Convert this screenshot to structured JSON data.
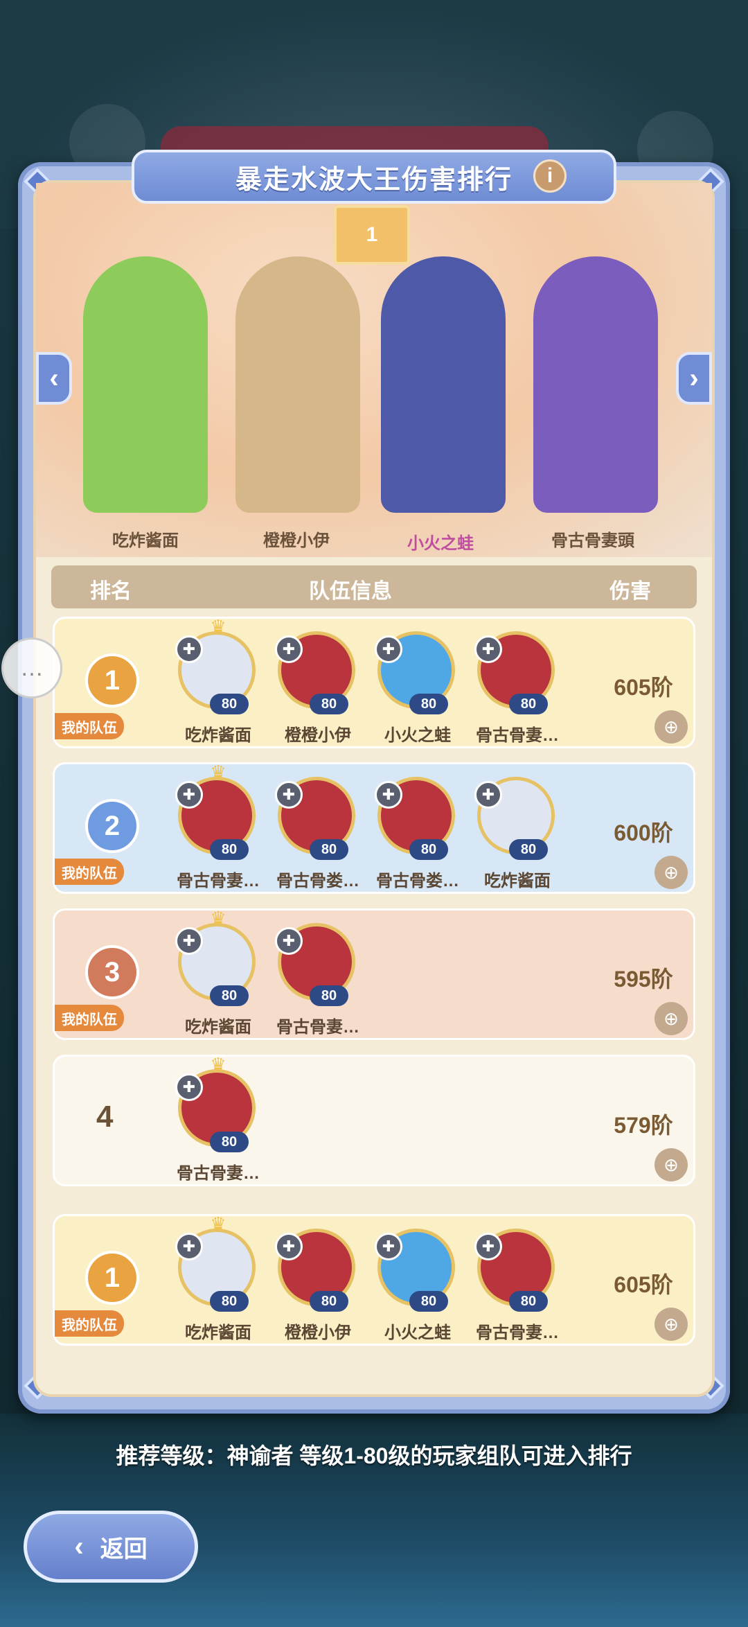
{
  "title": "暴走水波大王伤害排行",
  "top_rank": "1",
  "characters": [
    {
      "name": "吃炸酱面",
      "color": "#8dcc5b"
    },
    {
      "name": "橙橙小伊",
      "color": "#d6b78a"
    },
    {
      "name": "小火之蛙",
      "color": "#4e5aa8"
    },
    {
      "name": "骨古骨妻頭",
      "color": "#7a5dbd"
    }
  ],
  "table_headers": {
    "rank": "排名",
    "team": "队伍信息",
    "damage": "伤害"
  },
  "my_team_label": "我的队伍",
  "rows": [
    {
      "rank": "1",
      "mine": true,
      "bg": "#fbefc6",
      "damage": "605阶",
      "members": [
        {
          "name": "吃炸酱面",
          "level": "80",
          "color": "#dfe6f2"
        },
        {
          "name": "橙橙小伊",
          "level": "80",
          "color": "#b9343d"
        },
        {
          "name": "小火之蛙",
          "level": "80",
          "color": "#4fa7e6"
        },
        {
          "name": "骨古骨妻…",
          "level": "80",
          "color": "#b9343d"
        }
      ]
    },
    {
      "rank": "2",
      "mine": true,
      "bg": "#d7e7f5",
      "damage": "600阶",
      "members": [
        {
          "name": "骨古骨妻…",
          "level": "80",
          "color": "#b9343d"
        },
        {
          "name": "骨古骨娄…",
          "level": "80",
          "color": "#b9343d"
        },
        {
          "name": "骨古骨娄…",
          "level": "80",
          "color": "#b9343d"
        },
        {
          "name": "吃炸酱面",
          "level": "80",
          "color": "#dfe6f2"
        }
      ]
    },
    {
      "rank": "3",
      "mine": true,
      "bg": "#f6dccb",
      "damage": "595阶",
      "members": [
        {
          "name": "吃炸酱面",
          "level": "80",
          "color": "#dfe6f2"
        },
        {
          "name": "骨古骨妻…",
          "level": "80",
          "color": "#b9343d"
        }
      ]
    },
    {
      "rank": "4",
      "mine": false,
      "bg": "#fbf6ec",
      "damage": "579阶",
      "members": [
        {
          "name": "骨古骨妻…",
          "level": "80",
          "color": "#b9343d"
        }
      ]
    },
    {
      "rank": "1",
      "mine": true,
      "bg": "#fbefc6",
      "damage": "605阶",
      "members": [
        {
          "name": "吃炸酱面",
          "level": "80",
          "color": "#dfe6f2"
        },
        {
          "name": "橙橙小伊",
          "level": "80",
          "color": "#b9343d"
        },
        {
          "name": "小火之蛙",
          "level": "80",
          "color": "#4fa7e6"
        },
        {
          "name": "骨古骨妻…",
          "level": "80",
          "color": "#b9343d"
        }
      ]
    }
  ],
  "recommend": "推荐等级：神谕者 等级1-80级的玩家组队可进入排行",
  "back_label": "返回",
  "colors": {
    "gold": "#e9a441",
    "silver": "#6f9be0",
    "bronze": "#d27b5c",
    "accent": "#6f8cd4"
  }
}
